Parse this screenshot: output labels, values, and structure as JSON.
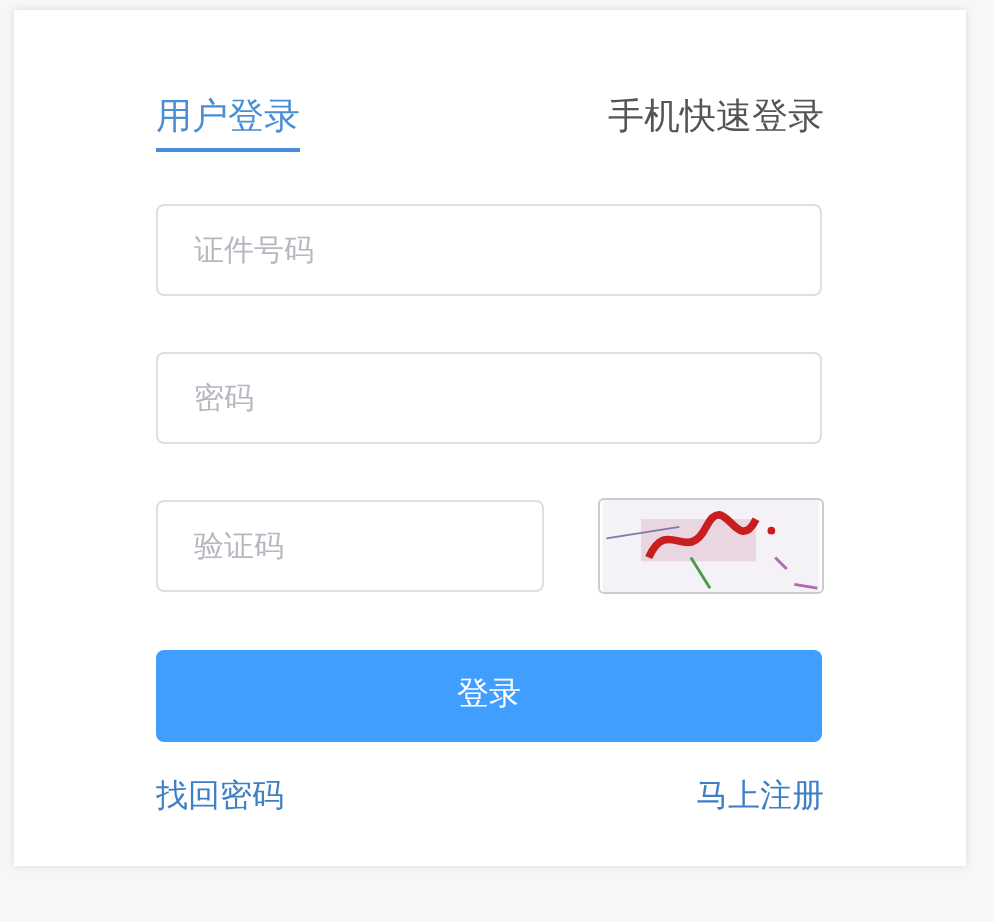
{
  "tabs": [
    {
      "label": "用户登录",
      "selected": true
    },
    {
      "label": "手机快速登录",
      "selected": false
    }
  ],
  "fields": [
    {
      "placeholder": "证件号码"
    },
    {
      "placeholder": "密码"
    }
  ],
  "captcha": {
    "placeholder": "验证码"
  },
  "submit": "登录",
  "links": [
    "找回密码",
    "马上注册"
  ]
}
